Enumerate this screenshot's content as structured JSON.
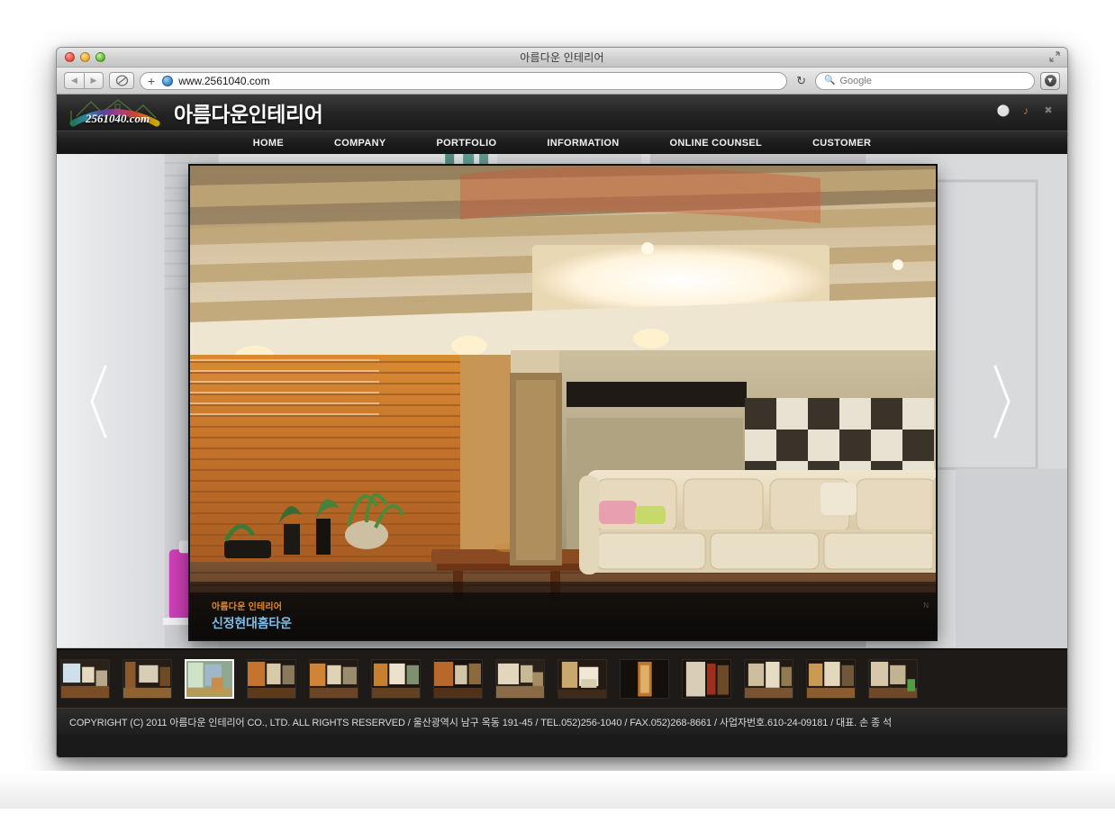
{
  "window": {
    "title": "아름다운 인테리어",
    "traffic_lights": [
      "close",
      "minimize",
      "zoom"
    ],
    "resize_icon": "resize-icon"
  },
  "toolbar": {
    "back_icon": "◀",
    "forward_icon": "▶",
    "share_icon": "share-icon",
    "plus_label": "+",
    "url": "www.2561040.com",
    "reload_icon": "↻",
    "search_placeholder": "Google",
    "search_glass": "search-icon",
    "downloads_icon": "downloads-icon"
  },
  "site": {
    "logo_text": "2561040.com",
    "brand": "아름다운인테리어",
    "header_icons": [
      {
        "name": "headphone-icon",
        "glyph": "☏",
        "color": "#2fb6b0"
      },
      {
        "name": "speaker-icon",
        "glyph": "◂",
        "color": "#d4762a"
      },
      {
        "name": "close-icon",
        "glyph": "✕",
        "color": "#7d7d7d"
      }
    ],
    "nav": [
      {
        "label": "HOME"
      },
      {
        "label": "COMPANY"
      },
      {
        "label": "PORTFOLIO"
      },
      {
        "label": "INFORMATION"
      },
      {
        "label": "ONLINE COUNSEL"
      },
      {
        "label": "CUSTOMER"
      }
    ],
    "hero": {
      "caption_small": "아름다운 인테리어",
      "caption_title": "신정현대홈타운",
      "caption_mark": "N",
      "prev_arrow": "prev-arrow",
      "next_arrow": "next-arrow"
    },
    "thumbnails": [
      {
        "index": 1,
        "selected": false
      },
      {
        "index": 2,
        "selected": false
      },
      {
        "index": 3,
        "selected": true
      },
      {
        "index": 4,
        "selected": false
      },
      {
        "index": 5,
        "selected": false
      },
      {
        "index": 6,
        "selected": false
      },
      {
        "index": 7,
        "selected": false
      },
      {
        "index": 8,
        "selected": false
      },
      {
        "index": 9,
        "selected": false
      },
      {
        "index": 10,
        "selected": false
      },
      {
        "index": 11,
        "selected": false
      },
      {
        "index": 12,
        "selected": false
      },
      {
        "index": 13,
        "selected": false
      },
      {
        "index": 14,
        "selected": false
      }
    ],
    "footer": "COPYRIGHT (C) 2011 아름다운 인테리어 CO., LTD. ALL RIGHTS RESERVED / 울산광역시 남구 옥동 191-45 / TEL.052)256-1040 / FAX.052)268-8661 / 사업자번호.610-24-09181 / 대표. 손 종 석"
  },
  "colors": {
    "accent_orange": "#e08a2c",
    "accent_blue": "#7fbde8",
    "header_dark": "#232323",
    "nav_dark": "#1c1c1c",
    "footer_dark": "#2b2b2b"
  }
}
